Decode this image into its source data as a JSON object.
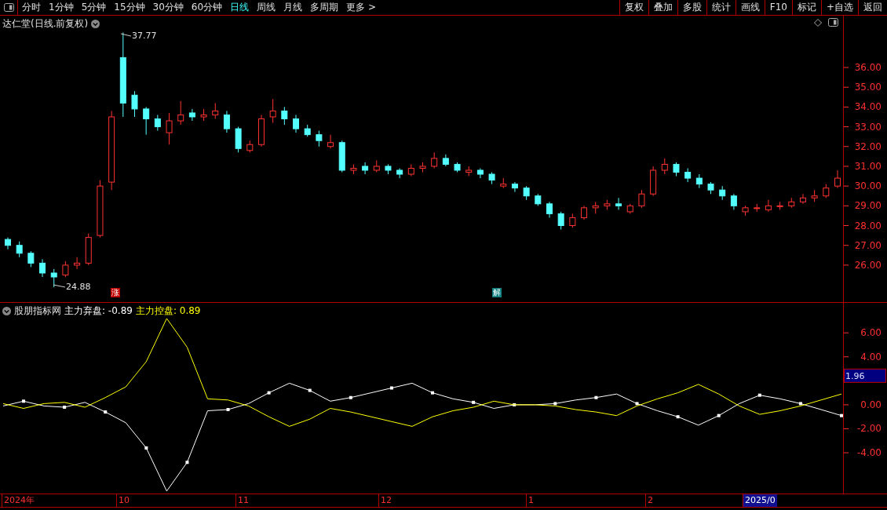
{
  "toolbar": {
    "periods": [
      {
        "label": "分时",
        "selected": false
      },
      {
        "label": "1分钟",
        "selected": false
      },
      {
        "label": "5分钟",
        "selected": false
      },
      {
        "label": "15分钟",
        "selected": false
      },
      {
        "label": "30分钟",
        "selected": false
      },
      {
        "label": "60分钟",
        "selected": false
      },
      {
        "label": "日线",
        "selected": true
      },
      {
        "label": "周线",
        "selected": false
      },
      {
        "label": "月线",
        "selected": false
      },
      {
        "label": "多周期",
        "selected": false
      },
      {
        "label": "更多 >",
        "selected": false
      }
    ],
    "actions": [
      "复权",
      "叠加",
      "多股",
      "统计",
      "画线",
      "F10",
      "标记",
      "+自选",
      "返回"
    ]
  },
  "price_panel": {
    "title": "达仁堂(日线.前复权)",
    "high_label": "37.77",
    "low_label": "24.88",
    "markers": [
      {
        "text": "涨",
        "color": "#c00000"
      },
      {
        "text": "解",
        "color": "#108080"
      }
    ],
    "chart_data": {
      "type": "candlestick",
      "ylim": [
        24.13,
        38.62
      ],
      "yticks": [
        {
          "value": 36,
          "label": "36.00"
        },
        {
          "value": 35,
          "label": "35.00"
        },
        {
          "value": 34,
          "label": "34.00"
        },
        {
          "value": 33,
          "label": "33.00"
        },
        {
          "value": 32,
          "label": "32.00"
        },
        {
          "value": 31,
          "label": "31.00"
        },
        {
          "value": 30,
          "label": "30.00"
        },
        {
          "value": 29,
          "label": "29.00"
        },
        {
          "value": 28,
          "label": "28.00"
        },
        {
          "value": 27,
          "label": "27.00"
        },
        {
          "value": 26,
          "label": "26.00"
        }
      ],
      "ohlc": [
        [
          27.3,
          27.4,
          26.8,
          27.0
        ],
        [
          27.0,
          27.2,
          26.4,
          26.6
        ],
        [
          26.6,
          26.7,
          25.9,
          26.1
        ],
        [
          26.1,
          26.3,
          25.4,
          25.6
        ],
        [
          25.6,
          25.8,
          24.88,
          25.4
        ],
        [
          25.5,
          26.2,
          25.4,
          26.0
        ],
        [
          26.0,
          26.4,
          25.8,
          26.1
        ],
        [
          26.1,
          27.6,
          26.0,
          27.4
        ],
        [
          27.5,
          30.3,
          27.4,
          30.0
        ],
        [
          30.2,
          33.8,
          29.8,
          33.5
        ],
        [
          36.5,
          37.77,
          33.5,
          34.2
        ],
        [
          34.6,
          34.8,
          33.5,
          33.9
        ],
        [
          33.9,
          34.0,
          32.6,
          33.4
        ],
        [
          33.4,
          33.6,
          32.8,
          33.0
        ],
        [
          32.7,
          33.7,
          32.1,
          33.3
        ],
        [
          33.3,
          34.3,
          33.1,
          33.6
        ],
        [
          33.7,
          33.9,
          33.3,
          33.5
        ],
        [
          33.5,
          33.9,
          33.3,
          33.6
        ],
        [
          33.6,
          34.2,
          33.4,
          33.8
        ],
        [
          33.6,
          33.8,
          32.7,
          32.9
        ],
        [
          32.9,
          33.0,
          31.7,
          31.9
        ],
        [
          31.8,
          32.3,
          31.7,
          32.1
        ],
        [
          32.1,
          33.6,
          32.0,
          33.4
        ],
        [
          33.5,
          34.4,
          33.2,
          33.8
        ],
        [
          33.8,
          34.0,
          33.1,
          33.4
        ],
        [
          33.4,
          33.6,
          32.7,
          32.9
        ],
        [
          32.9,
          33.1,
          32.5,
          32.6
        ],
        [
          32.6,
          32.8,
          32.0,
          32.3
        ],
        [
          32.0,
          32.6,
          31.9,
          32.2
        ],
        [
          32.2,
          32.3,
          30.7,
          30.8
        ],
        [
          30.8,
          31.1,
          30.6,
          30.9
        ],
        [
          31.0,
          31.2,
          30.6,
          30.8
        ],
        [
          30.8,
          31.3,
          30.7,
          31.0
        ],
        [
          31.0,
          31.1,
          30.6,
          30.8
        ],
        [
          30.8,
          30.9,
          30.4,
          30.6
        ],
        [
          30.6,
          31.1,
          30.5,
          30.9
        ],
        [
          30.9,
          31.2,
          30.7,
          31.0
        ],
        [
          31.0,
          31.7,
          30.9,
          31.4
        ],
        [
          31.4,
          31.6,
          31.0,
          31.1
        ],
        [
          31.1,
          31.2,
          30.7,
          30.8
        ],
        [
          30.7,
          31.0,
          30.5,
          30.8
        ],
        [
          30.8,
          30.9,
          30.4,
          30.6
        ],
        [
          30.6,
          30.7,
          30.1,
          30.3
        ],
        [
          30.0,
          30.4,
          29.9,
          30.1
        ],
        [
          30.1,
          30.2,
          29.7,
          29.9
        ],
        [
          29.9,
          30.0,
          29.3,
          29.5
        ],
        [
          29.5,
          29.6,
          29.0,
          29.1
        ],
        [
          29.1,
          29.2,
          28.4,
          28.6
        ],
        [
          28.6,
          28.7,
          27.8,
          28.0
        ],
        [
          28.0,
          28.6,
          27.9,
          28.4
        ],
        [
          28.4,
          29.0,
          28.3,
          28.9
        ],
        [
          28.9,
          29.2,
          28.6,
          29.0
        ],
        [
          29.0,
          29.3,
          28.8,
          29.1
        ],
        [
          29.1,
          29.4,
          28.8,
          29.0
        ],
        [
          28.7,
          29.1,
          28.6,
          29.0
        ],
        [
          29.0,
          29.8,
          28.9,
          29.6
        ],
        [
          29.6,
          31.0,
          29.5,
          30.8
        ],
        [
          30.8,
          31.4,
          30.6,
          31.1
        ],
        [
          31.1,
          31.2,
          30.5,
          30.7
        ],
        [
          30.7,
          30.9,
          30.2,
          30.4
        ],
        [
          30.4,
          30.6,
          29.9,
          30.1
        ],
        [
          30.1,
          30.2,
          29.6,
          29.8
        ],
        [
          29.8,
          30.0,
          29.3,
          29.5
        ],
        [
          29.5,
          29.6,
          28.8,
          29.0
        ],
        [
          28.7,
          29.0,
          28.5,
          28.9
        ],
        [
          28.9,
          29.1,
          28.7,
          28.9
        ],
        [
          28.8,
          29.3,
          28.7,
          29.0
        ],
        [
          29.0,
          29.2,
          28.8,
          29.0
        ],
        [
          29.0,
          29.4,
          28.9,
          29.2
        ],
        [
          29.2,
          29.6,
          29.1,
          29.4
        ],
        [
          29.4,
          29.8,
          29.2,
          29.5
        ],
        [
          29.5,
          30.1,
          29.4,
          29.9
        ],
        [
          30.0,
          30.8,
          29.9,
          30.4
        ]
      ]
    }
  },
  "indicator_panel": {
    "name": "股朋指标网",
    "readouts": [
      ": -0.89",
      ": 0.89"
    ],
    "current_value": "1.96",
    "chart_data": {
      "type": "line",
      "ylim": [
        -7.4,
        8.5
      ],
      "yticks": [
        {
          "value": 6,
          "label": "6.00"
        },
        {
          "value": 4,
          "label": "4.00"
        },
        {
          "value": 0,
          "label": "0.00"
        },
        {
          "value": -2,
          "label": "-2.00"
        },
        {
          "value": -4,
          "label": "-4.00"
        }
      ],
      "series": [
        {
          "name": "主力弃盘",
          "color": "#ffffff",
          "values": [
            -0.1,
            0.3,
            -0.1,
            -0.2,
            0.2,
            -0.6,
            -1.5,
            -3.6,
            -7.2,
            -4.8,
            -0.5,
            -0.4,
            0.1,
            1.0,
            1.8,
            1.2,
            0.3,
            0.6,
            1.0,
            1.4,
            1.8,
            1.0,
            0.5,
            0.2,
            -0.3,
            0,
            0,
            0.1,
            0.4,
            0.6,
            0.9,
            0.1,
            -0.5,
            -1.0,
            -1.7,
            -0.9,
            0.1,
            0.8,
            0.5,
            0.1,
            -0.4,
            -0.9
          ]
        },
        {
          "name": "主力控盘",
          "color": "#ffff00",
          "values": [
            0.1,
            -0.3,
            0.1,
            0.2,
            -0.2,
            0.6,
            1.5,
            3.6,
            7.2,
            4.8,
            0.5,
            0.4,
            -0.1,
            -1.0,
            -1.8,
            -1.2,
            -0.3,
            -0.6,
            -1.0,
            -1.4,
            -1.8,
            -1.0,
            -0.5,
            -0.2,
            0.3,
            0,
            0,
            -0.1,
            -0.4,
            -0.6,
            -0.9,
            -0.1,
            0.5,
            1.0,
            1.7,
            0.9,
            -0.1,
            -0.8,
            -0.5,
            -0.1,
            0.4,
            0.9
          ]
        }
      ]
    }
  },
  "time_axis": {
    "labels": [
      {
        "text": "2024年",
        "selected": false
      },
      {
        "text": "10",
        "selected": false
      },
      {
        "text": "11",
        "selected": false
      },
      {
        "text": "12",
        "selected": false
      },
      {
        "text": "1",
        "selected": false
      },
      {
        "text": "2",
        "selected": false
      },
      {
        "text": "2025/0",
        "selected": true
      }
    ]
  }
}
